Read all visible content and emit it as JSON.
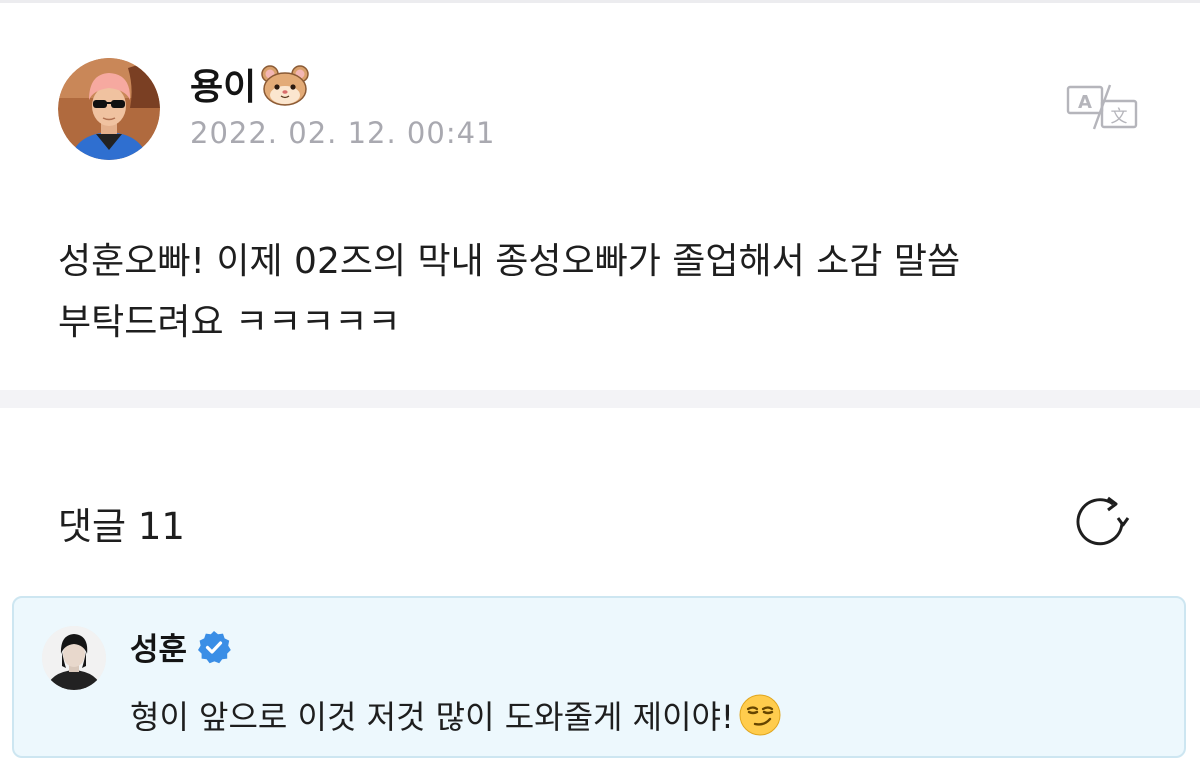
{
  "post": {
    "author_name": "용이",
    "author_emoji_icon": "hamster-face-icon",
    "timestamp": "2022. 02. 12. 00:41",
    "body": "성훈오빠! 이제 02즈의 막내 종성오빠가 졸업해서 소감 말씀\n부탁드려요 ㅋㅋㅋㅋㅋ",
    "translate_icon": "translate-icon"
  },
  "comments": {
    "header": "댓글 11",
    "refresh_icon": "refresh-icon",
    "items": [
      {
        "author_name": "성훈",
        "verified_icon": "verified-badge-icon",
        "text": "형이 앞으로 이것 저것 많이 도와줄게 제이야!",
        "emoji_icon": "smirking-face-icon"
      }
    ]
  },
  "colors": {
    "comment_bg": "#edf8fd",
    "comment_border": "#cde6f1",
    "verified_blue": "#3a8ee6",
    "timestamp_gray": "#a9a9b0",
    "divider": "#f3f3f6"
  }
}
